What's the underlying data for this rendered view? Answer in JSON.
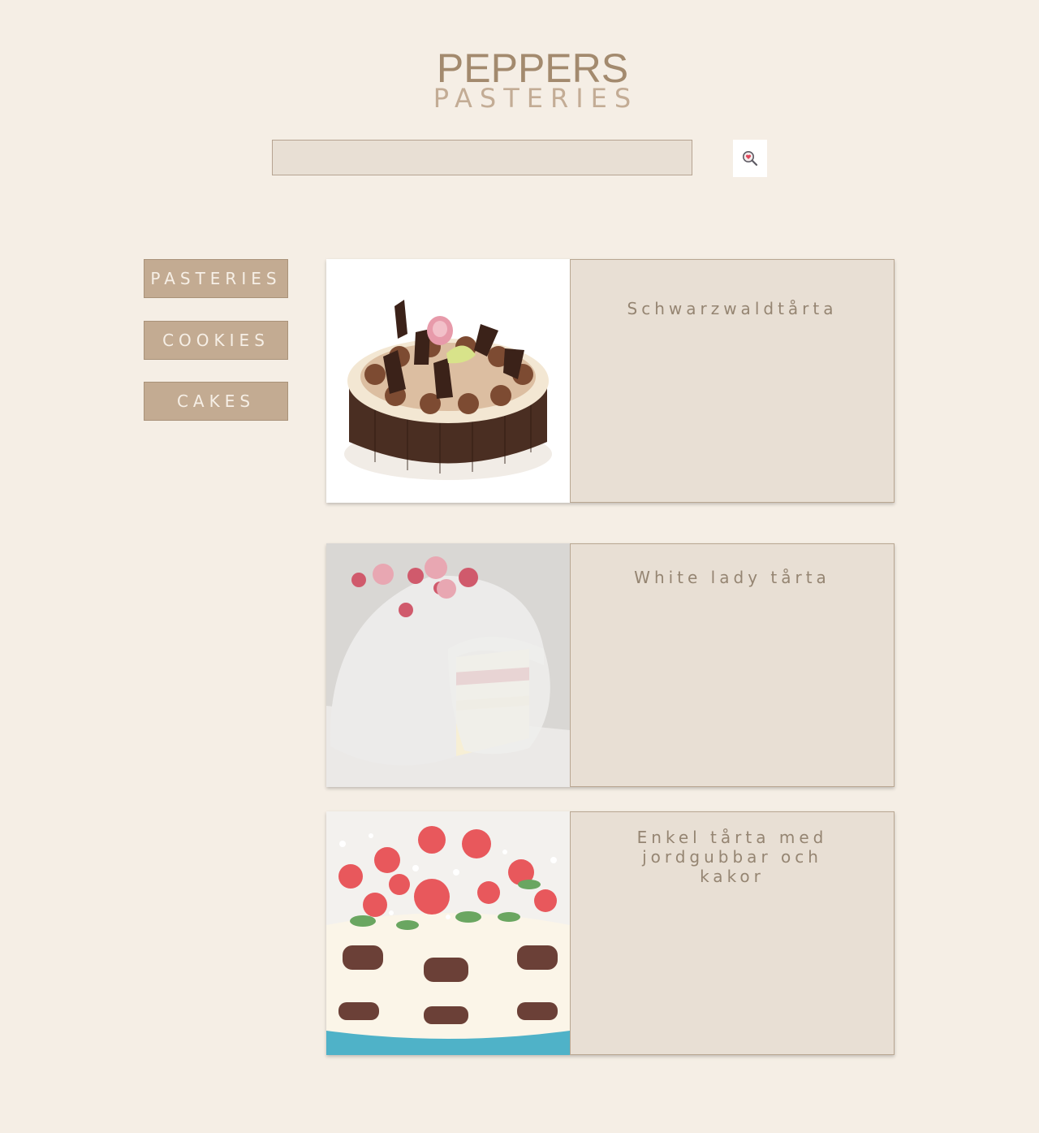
{
  "header": {
    "brand_title": "PEPPERS",
    "brand_subtitle": "PASTERIES"
  },
  "search": {
    "value": "",
    "placeholder": "",
    "icon": "magnifier-heart-icon"
  },
  "sidebar": {
    "items": [
      {
        "label": "PASTERIES"
      },
      {
        "label": "COOKIES"
      },
      {
        "label": "CAKES"
      }
    ]
  },
  "products": [
    {
      "title": "Schwarzwaldtårta",
      "image": "chocolate-cake-photo"
    },
    {
      "title": "White lady tårta",
      "image": "white-princess-cake-photo"
    },
    {
      "title": "Enkel tårta med jordgubbar och kakor",
      "image": "strawberry-cookie-cake-photo"
    }
  ],
  "colors": {
    "background": "#f5eee5",
    "brand": "#a38a6e",
    "button": "#c3ab92",
    "card_panel": "#e8dfd4",
    "card_text": "#958572"
  }
}
